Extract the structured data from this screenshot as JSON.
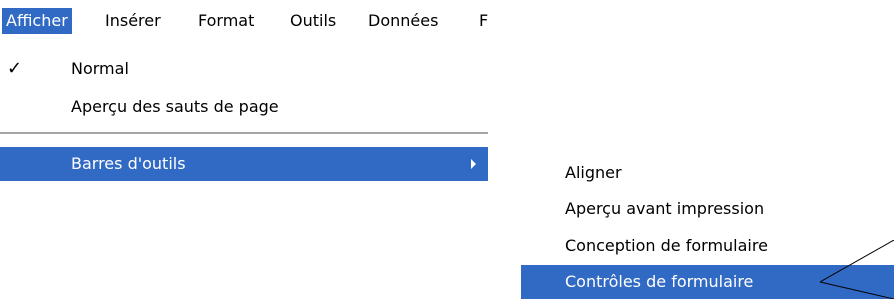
{
  "colors": {
    "highlight": "#316ac5",
    "highlight_text": "#ffffff",
    "separator": "#a6a6a6"
  },
  "menubar": {
    "items": [
      {
        "label": "Afficher",
        "active": true
      },
      {
        "label": "Insérer"
      },
      {
        "label": "Format"
      },
      {
        "label": "Outils"
      },
      {
        "label": "Données"
      },
      {
        "label": "F"
      }
    ]
  },
  "view_menu": {
    "items": [
      {
        "label": "Normal",
        "checked": true
      },
      {
        "label": "Aperçu des sauts de page"
      },
      {
        "label": "Barres d'outils",
        "highlighted": true,
        "has_submenu": true
      }
    ]
  },
  "toolbars_submenu": {
    "items": [
      {
        "label": "Aligner"
      },
      {
        "label": "Aperçu avant impression"
      },
      {
        "label": "Conception de formulaire"
      },
      {
        "label": "Contrôles de formulaire",
        "highlighted": true
      }
    ]
  },
  "icons": {
    "checkmark": "checkmark-icon",
    "submenu_arrow": "submenu-arrow-icon",
    "callout": "callout-pointer"
  }
}
